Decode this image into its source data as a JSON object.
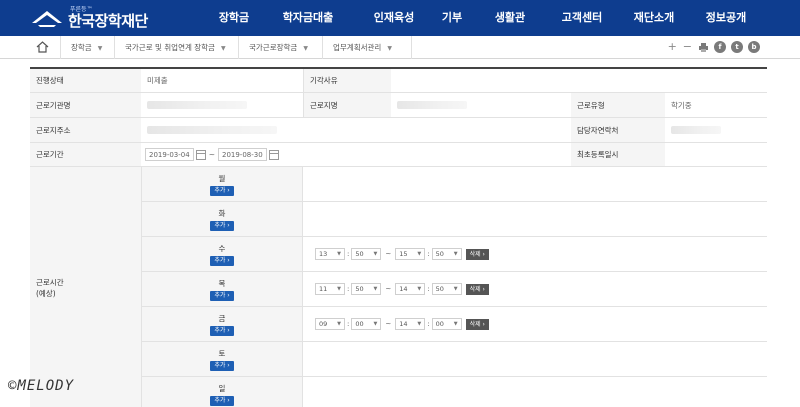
{
  "header": {
    "logo_sub": "푸른등™",
    "logo_main": "한국장학재단",
    "menu": [
      "장학금",
      "학자금대출",
      "인재육성",
      "기부",
      "생활관",
      "고객센터",
      "재단소개",
      "정보공개"
    ]
  },
  "breadcrumb": {
    "home_icon": "home-icon",
    "items": [
      "장학금",
      "국가근로 및 취업연계 장학금",
      "국가근로장학금",
      "업무계획서관리"
    ]
  },
  "tools": [
    "+",
    "−",
    "print-icon",
    "f",
    "t",
    "b"
  ],
  "form": {
    "status_label": "진행상태",
    "status_value": "미제출",
    "reject_label": "기각사유",
    "reject_value": "",
    "org_label": "근로기관명",
    "site_label": "근로지명",
    "type_label": "근로유형",
    "type_value": "학기중",
    "addr_label": "근로지주소",
    "contact_label": "담당자연락처",
    "period_label": "근로기간",
    "period_start": "2019-03-04",
    "period_end": "2019-08-30",
    "first_reg_label": "최초등록일시",
    "first_reg_value": "",
    "worktime_label": "근로시간",
    "worktime_sub": "(예상)",
    "add_label": "추가 ›",
    "delete_label": "삭제 ›",
    "days": [
      {
        "day": "월",
        "slots": []
      },
      {
        "day": "화",
        "slots": []
      },
      {
        "day": "수",
        "slots": [
          {
            "sh": "13",
            "sm": "50",
            "eh": "15",
            "em": "50"
          }
        ]
      },
      {
        "day": "목",
        "slots": [
          {
            "sh": "11",
            "sm": "50",
            "eh": "14",
            "em": "50"
          }
        ]
      },
      {
        "day": "금",
        "slots": [
          {
            "sh": "09",
            "sm": "00",
            "eh": "14",
            "em": "00"
          }
        ]
      },
      {
        "day": "토",
        "slots": []
      },
      {
        "day": "일",
        "slots": []
      }
    ]
  },
  "watermark": "©MELODY"
}
